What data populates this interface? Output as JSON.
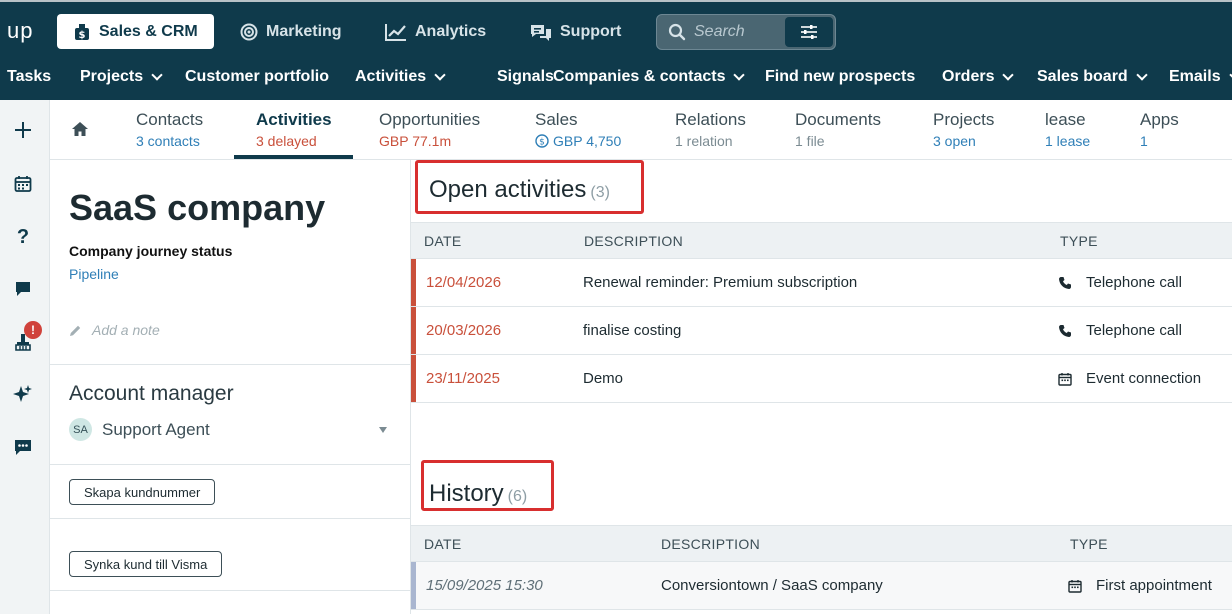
{
  "app": {
    "logo": "up",
    "main_tabs": [
      {
        "label": "Sales & CRM",
        "icon": "dollar-bag-icon",
        "active": true
      },
      {
        "label": "Marketing",
        "icon": "target-icon",
        "active": false
      },
      {
        "label": "Analytics",
        "icon": "line-chart-icon",
        "active": false
      },
      {
        "label": "Support",
        "icon": "chat-bubbles-icon",
        "active": false
      }
    ],
    "search": {
      "placeholder": "Search"
    },
    "subnav": [
      {
        "label": "Tasks",
        "dropdown": false
      },
      {
        "label": "Projects",
        "dropdown": true
      },
      {
        "label": "Customer portfolio",
        "dropdown": false
      },
      {
        "label": "Activities",
        "dropdown": true
      },
      {
        "label": "Signals",
        "dropdown": false
      },
      {
        "label": "Companies & contacts",
        "dropdown": true
      },
      {
        "label": "Find new prospects",
        "dropdown": false
      },
      {
        "label": "Orders",
        "dropdown": true
      },
      {
        "label": "Sales board",
        "dropdown": true
      },
      {
        "label": "Emails",
        "dropdown": true
      }
    ]
  },
  "rail": {
    "icons": [
      "plus-icon",
      "calendar-icon",
      "help-icon",
      "chat-icon",
      "broom-icon",
      "sparkle-icon",
      "message-icon"
    ],
    "alert_badge": "!"
  },
  "tabs": [
    {
      "title": "Contacts",
      "sub": "3 contacts",
      "style": "link"
    },
    {
      "title": "Activities",
      "sub": "3 delayed",
      "style": "red",
      "active": true
    },
    {
      "title": "Opportunities",
      "sub": "GBP 77.1m",
      "style": "red"
    },
    {
      "title": "Sales",
      "sub": "GBP 4,750",
      "style": "link"
    },
    {
      "title": "Relations",
      "sub": "1 relation",
      "style": "muted"
    },
    {
      "title": "Documents",
      "sub": "1 file",
      "style": "muted"
    },
    {
      "title": "Projects",
      "sub": "3 open",
      "style": "link"
    },
    {
      "title": "lease",
      "sub": "1 lease",
      "style": "link"
    },
    {
      "title": "Apps",
      "sub": "1",
      "style": "link"
    }
  ],
  "company": {
    "name": "SaaS company",
    "journey_label": "Company journey status",
    "journey_value": "Pipeline",
    "note_placeholder": "Add a note",
    "account_manager_label": "Account manager",
    "account_manager": {
      "initials": "SA",
      "name": "Support Agent"
    },
    "buttons": [
      "Skapa kundnummer",
      "Synka kund till Visma"
    ]
  },
  "open_activities": {
    "title": "Open activities",
    "count": "(3)",
    "columns": [
      "DATE",
      "DESCRIPTION",
      "TYPE"
    ],
    "rows": [
      {
        "date": "12/04/2026",
        "description": "Renewal reminder: Premium subscription",
        "type": "Telephone call",
        "icon": "phone-icon"
      },
      {
        "date": "20/03/2026",
        "description": "finalise costing",
        "type": "Telephone call",
        "icon": "phone-icon"
      },
      {
        "date": "23/11/2025",
        "description": "Demo",
        "type": "Event connection",
        "icon": "calendar-icon"
      }
    ]
  },
  "history": {
    "title": "History",
    "count": "(6)",
    "columns": [
      "DATE",
      "DESCRIPTION",
      "TYPE"
    ],
    "rows": [
      {
        "date": "15/09/2025 15:30",
        "description": "Conversiontown / SaaS company",
        "type": "First appointment",
        "icon": "calendar-icon"
      }
    ]
  },
  "colors": {
    "navy": "#0f3a4b",
    "link": "#2f7fb7",
    "overdue": "#c9503b",
    "highlight": "#d82f2f"
  }
}
